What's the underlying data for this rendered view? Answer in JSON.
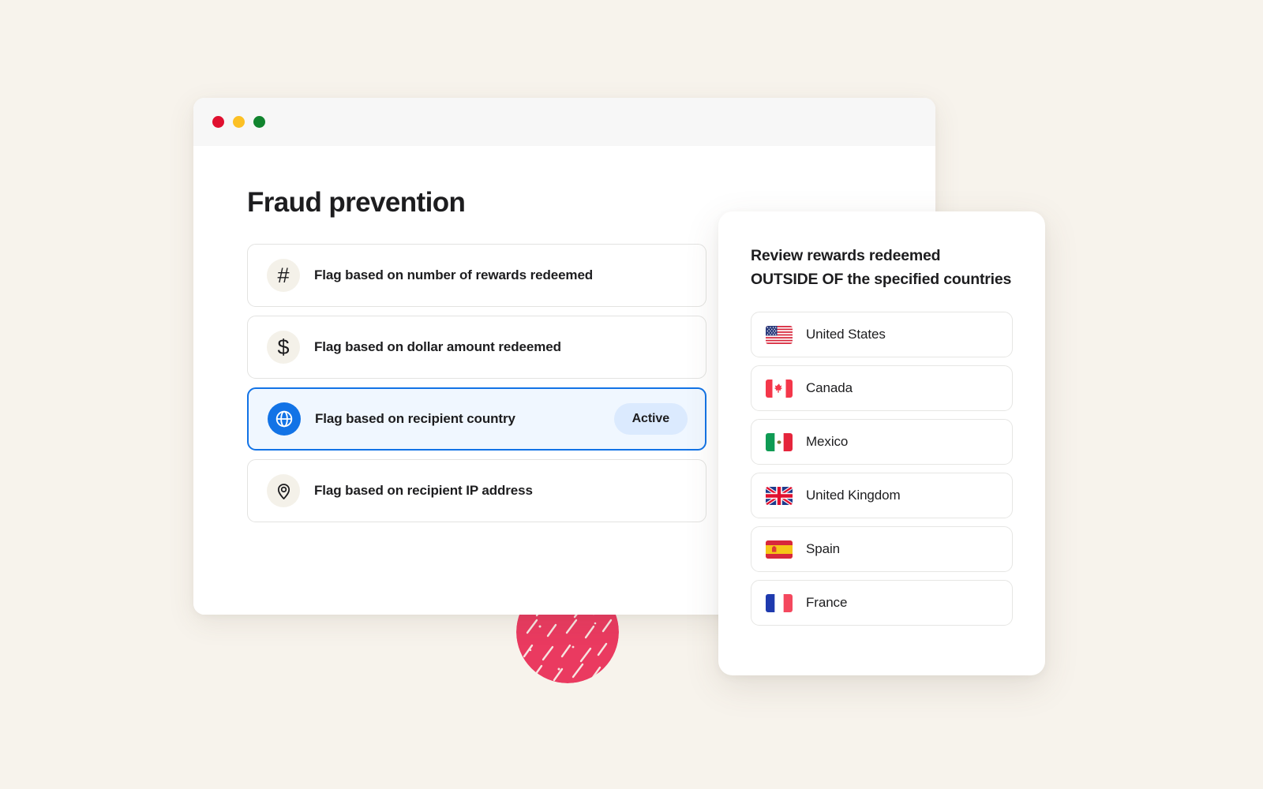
{
  "window": {
    "title_bar": {
      "buttons": [
        {
          "name": "close",
          "icon": "close-dot",
          "color": "#e0102f"
        },
        {
          "name": "minimize",
          "icon": "minimize-dot",
          "color": "#fcc024"
        },
        {
          "name": "zoom",
          "icon": "zoom-dot",
          "color": "#11842e"
        }
      ]
    },
    "page_title": "Fraud prevention"
  },
  "rules": [
    {
      "label": "Flag based on number of rewards redeemed",
      "icon": "hash-icon",
      "glyph": "#",
      "active": false,
      "status": ""
    },
    {
      "label": "Flag based on dollar amount redeemed",
      "icon": "dollar-icon",
      "glyph": "$",
      "active": false,
      "status": ""
    },
    {
      "label": "Flag based on recipient country",
      "icon": "globe-icon",
      "glyph": "",
      "active": true,
      "status": "Active"
    },
    {
      "label": "Flag based on recipient IP address",
      "icon": "map-pin-icon",
      "glyph": "",
      "active": false,
      "status": ""
    }
  ],
  "countries_panel": {
    "heading_line1": "Review rewards redeemed",
    "heading_line2": "OUTSIDE OF the specified countries",
    "heading": "Review rewards redeemed OUTSIDE OF the specified countries",
    "countries": [
      {
        "name": "United States",
        "icon": "flag-united-states-icon"
      },
      {
        "name": "Canada",
        "icon": "flag-canada-icon"
      },
      {
        "name": "Mexico",
        "icon": "flag-mexico-icon"
      },
      {
        "name": "United Kingdom",
        "icon": "flag-united-kingdom-icon"
      },
      {
        "name": "Spain",
        "icon": "flag-spain-icon"
      },
      {
        "name": "France",
        "icon": "flag-france-icon"
      }
    ]
  },
  "decoration": {
    "shape": "scribble-circle",
    "color": "#ea3a60"
  },
  "colors": {
    "background": "#f7f3ec",
    "accent_blue": "#1273e6",
    "active_row_fill": "#f0f7ff",
    "pill_fill": "#dbeafe",
    "icon_circle": "#f4f1e9",
    "text": "#1d1d1f"
  }
}
